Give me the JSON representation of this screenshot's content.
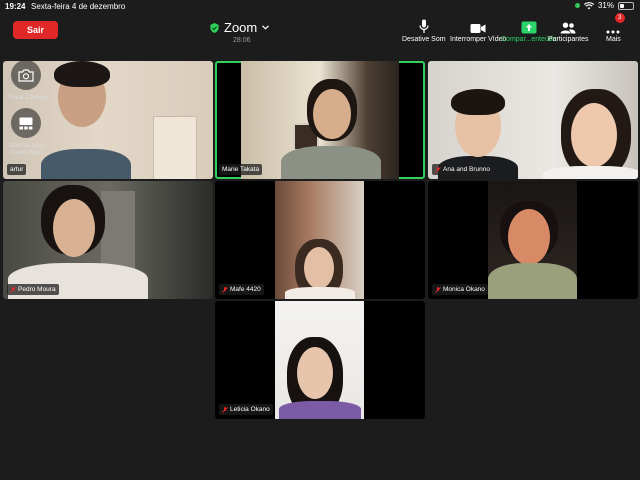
{
  "status_bar": {
    "time": "19:24",
    "date": "Sexta-feira 4 de dezembro",
    "battery": "31%",
    "battery_level": 0.31
  },
  "toolbar": {
    "leave_label": "Sair",
    "title": "Zoom",
    "duration": "28:06",
    "mute_label": "Desative Som",
    "video_label": "Interromper Vídeo",
    "share_label": "Compar...enteúdo",
    "participants_label": "Participantes",
    "more_label": "Mais",
    "more_badge": "3"
  },
  "overlay": {
    "switch_camera_label": "Trocar Câmera",
    "switch_speaker_label": "Alternar para Orador Ativo"
  },
  "participants": [
    {
      "name": "artur"
    },
    {
      "name": "Marie Takata"
    },
    {
      "name": "Ana and Brunno"
    },
    {
      "name": "Pedro Moura"
    },
    {
      "name": "Mafe 4420"
    },
    {
      "name": "Monica Okano"
    },
    {
      "name": "Leticia Okano"
    }
  ],
  "colors": {
    "background": "#1c1c1c",
    "leave_button": "#e02828",
    "active_speaker_border": "#2fd15a",
    "share_green": "#2bd36a"
  }
}
